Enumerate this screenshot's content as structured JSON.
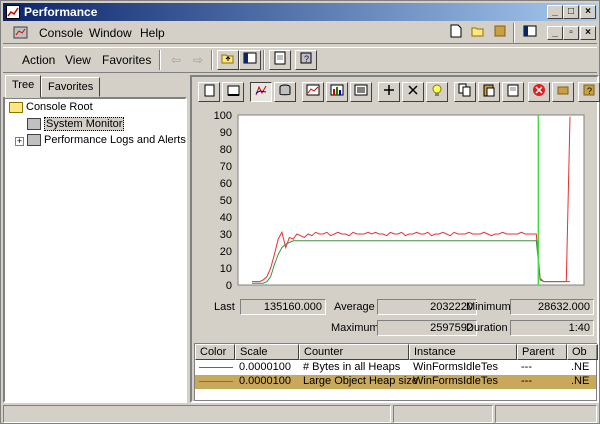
{
  "window": {
    "title": "Performance",
    "colors": {
      "titlebar": "#0a246a",
      "red_series": "#e83030",
      "green_series": "#409040",
      "cursor_line": "#40e040",
      "selected_row": "#c8a85a"
    }
  },
  "menu": {
    "items": [
      "Console",
      "Window",
      "Help"
    ]
  },
  "action_bar": {
    "items": [
      "Action",
      "View",
      "Favorites"
    ]
  },
  "left": {
    "tabs": [
      "Tree",
      "Favorites"
    ],
    "tree": {
      "root": "Console Root",
      "children": [
        "System Monitor",
        "Performance Logs and Alerts"
      ]
    }
  },
  "toolbar_icons": [
    "new-counter-set-icon",
    "clear-display-icon",
    "view-current-activity-icon",
    "view-log-data-icon",
    "view-graph-icon",
    "view-histogram-icon",
    "view-report-icon",
    "add-counter-icon",
    "delete-counter-icon",
    "highlight-icon",
    "copy-properties-icon",
    "paste-counter-list-icon",
    "properties-icon",
    "freeze-display-icon",
    "update-data-icon",
    "help-icon"
  ],
  "stats": {
    "last_label": "Last",
    "last": "135160.000",
    "average_label": "Average",
    "average": "2032220",
    "minimum_label": "Minimum",
    "minimum": "28632.000",
    "maximum_label": "Maximum",
    "maximum": "2597592",
    "duration_label": "Duration",
    "duration": "1:40"
  },
  "legend": {
    "headers": [
      "Color",
      "Scale",
      "Counter",
      "Instance",
      "Parent",
      "Ob"
    ],
    "rows": [
      {
        "scale": "0.0000100",
        "counter": "# Bytes in all Heaps",
        "instance": "WinFormsIdleTes",
        "parent": "---",
        "object": ".NE"
      },
      {
        "scale": "0.0000100",
        "counter": "Large Object Heap size",
        "instance": "WinFormsIdleTes",
        "parent": "---",
        "object": ".NE"
      }
    ]
  },
  "chart_data": {
    "type": "line",
    "title": "",
    "ylim": [
      0,
      100
    ],
    "yticks": [
      "100",
      "90",
      "80",
      "70",
      "60",
      "50",
      "40",
      "30",
      "20",
      "10",
      "0"
    ],
    "grid": false,
    "legend": "bottom",
    "cursor_fraction": 0.868,
    "series": [
      {
        "color": "#e83030",
        "values": [
          2,
          2,
          2,
          3,
          5,
          10,
          18,
          27,
          31,
          22,
          28,
          27,
          30,
          29,
          28,
          30,
          29,
          31,
          30,
          30,
          31,
          29,
          30,
          31,
          30,
          30,
          29,
          31,
          30,
          30,
          30,
          31,
          30,
          31,
          30,
          30,
          29,
          31,
          30,
          30,
          31,
          29,
          30,
          30,
          31,
          30,
          30,
          31,
          29,
          30,
          30,
          31,
          30,
          29,
          31,
          30,
          30,
          30,
          31,
          30,
          30,
          30,
          31,
          30,
          29,
          30,
          30,
          31,
          30,
          30,
          30,
          30,
          31,
          30,
          30,
          30,
          30,
          4,
          2,
          2,
          2,
          2,
          2,
          2,
          2,
          99
        ]
      },
      {
        "color": "#409040",
        "values": [
          1,
          1,
          1,
          1,
          2,
          5,
          12,
          18,
          22,
          24,
          25,
          26,
          26,
          26,
          26,
          26,
          26,
          26,
          26,
          26,
          26,
          26,
          26,
          26,
          26,
          26,
          26,
          26,
          26,
          26,
          26,
          26,
          26,
          26,
          26,
          26,
          26,
          26,
          26,
          26,
          26,
          26,
          26,
          26,
          26,
          26,
          26,
          26,
          26,
          26,
          26,
          26,
          26,
          26,
          26,
          26,
          26,
          26,
          26,
          26,
          26,
          26,
          26,
          26,
          26,
          26,
          26,
          26,
          26,
          26,
          26,
          26,
          26,
          26,
          26,
          26,
          26,
          3,
          2,
          2,
          2,
          2,
          2,
          2,
          2,
          2
        ]
      }
    ]
  },
  "status": {
    "panes": [
      "",
      "",
      ""
    ]
  }
}
